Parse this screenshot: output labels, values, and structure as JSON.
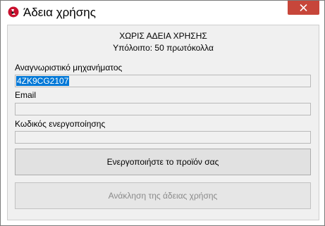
{
  "window": {
    "title": "Άδεια χρήσης"
  },
  "status": {
    "line1": "ΧΩΡΙΣ ΑΔΕΙΑ ΧΡΗΣΗΣ",
    "line2": "Υπόλοιπο: 50 πρωτόκολλα"
  },
  "fields": {
    "machine_id": {
      "label": "Αναγνωριστικό μηχανήματος",
      "value": "4ZK9CG2107"
    },
    "email": {
      "label": "Email",
      "value": ""
    },
    "activation_code": {
      "label": "Κωδικός ενεργοποίησης",
      "value": ""
    }
  },
  "buttons": {
    "activate": "Ενεργοποιήστε το προϊόν σας",
    "revoke": "Ανάκληση της άδειας χρήσης"
  },
  "colors": {
    "close_button": "#c7463a",
    "selection": "#0078d7"
  }
}
